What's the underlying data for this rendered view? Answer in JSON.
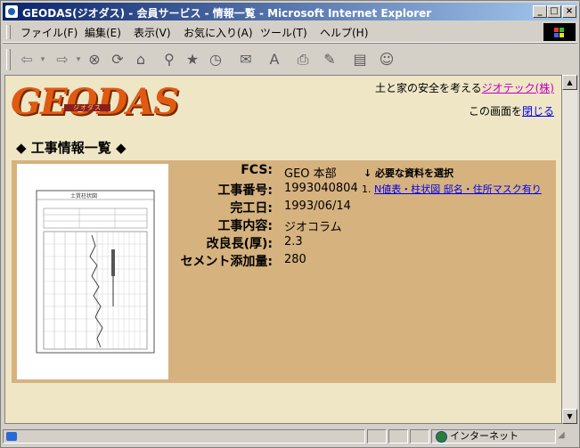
{
  "window": {
    "title": "GEODAS(ジオダス) - 会員サービス - 情報一覧 - Microsoft Internet Explorer"
  },
  "menu": {
    "items": [
      "ファイル(F)",
      "編集(E)",
      "表示(V)",
      "お気に入り(A)",
      "ツール(T)",
      "ヘルプ(H)"
    ]
  },
  "page": {
    "logo_text": "GEODAS",
    "logo_sub": "ジオダス",
    "tagline": "土と家の安全を考える",
    "company_link": "ジオテック(株)",
    "close_prefix": "この画面を",
    "close_link": "閉じる",
    "section_title": "◆ 工事情報一覧 ◆",
    "thumbnail_caption": "土質柱状図"
  },
  "record": {
    "fields": [
      {
        "label": "FCS:",
        "value": "GEO 本部"
      },
      {
        "label": "工事番号:",
        "value": "1993040804"
      },
      {
        "label": "完工日:",
        "value": "1993/06/14"
      },
      {
        "label": "工事内容:",
        "value": "ジオコラム"
      },
      {
        "label": "改良長(厚):",
        "value": "2.3"
      },
      {
        "label": "セメント添加量:",
        "value": "280"
      }
    ],
    "doc_select_label": "↓ 必要な資料を選択",
    "doc_number": "1.",
    "doc_link": "N値表・柱状図 邸名・住所マスク有り"
  },
  "status": {
    "zone": "インターネット"
  }
}
